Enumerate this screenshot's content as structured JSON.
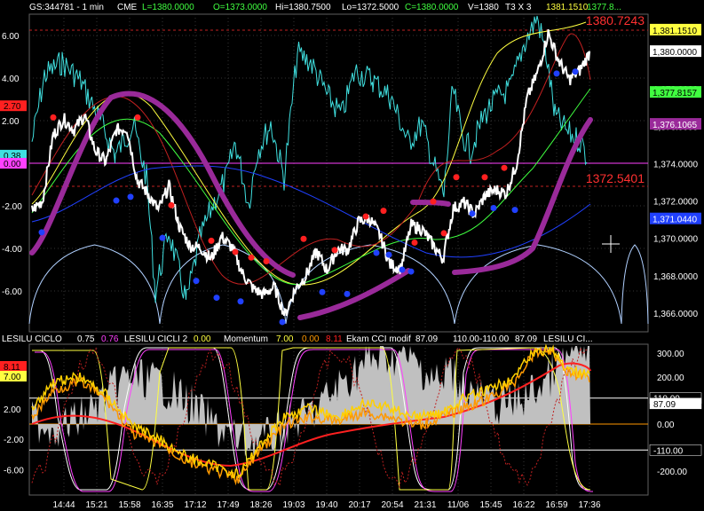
{
  "header": {
    "symbol": "GS:344781 - 1 min",
    "exchange": "CME",
    "last": "L=1380.0000",
    "open": "O=1373.0000",
    "high": "Hi=1380.7500",
    "low": "Lo=1372.5000",
    "close": "C=1380.0000",
    "volume": "V=1380",
    "chart_setting": "T3 X 3",
    "value_a": "1381.1510",
    "value_b": "1377.8..."
  },
  "colors": {
    "background": "#000000",
    "price": "#ffffff",
    "cyan_line": "#40e0e0",
    "purple_band": "#9a2a9a",
    "magenta_line": "#ff40ff",
    "red_dot": "#ff2020",
    "blue_dot": "#2040ff",
    "yellow": "#ffff40",
    "orange": "#ff9900",
    "grey_fill": "#c0c0c0"
  },
  "upper_panel": {
    "right_axis_ticks": [
      "1,380.0000",
      "1,378.0000",
      "1,376.0000",
      "1,374.0000",
      "1,372.0000",
      "1,370.0000",
      "1,368.0000",
      "1,366.0000"
    ],
    "left_axis_ticks": [
      "6.00",
      "4.00",
      "2.00",
      "0.00",
      "-2.00",
      "-4.00",
      "-6.00"
    ],
    "level_top": "1380.7243",
    "level_bottom": "1372.5401",
    "badges": [
      {
        "text": "1,381.1510",
        "bg": "#ffff40",
        "fg": "#000000"
      },
      {
        "text": "1,380.0000",
        "bg": "#ffffff",
        "fg": "#000000"
      },
      {
        "text": "1,377.8157",
        "bg": "#40ff40",
        "fg": "#000000"
      },
      {
        "text": "1,376.1065",
        "bg": "#9a2a9a",
        "fg": "#ffffff"
      },
      {
        "text": "1,371.0440",
        "bg": "#2040ff",
        "fg": "#ffffff"
      }
    ],
    "left_badges": [
      {
        "text": "2.70",
        "bg": "#ff2020"
      },
      {
        "text": "0.38",
        "bg": "#40e0e0"
      },
      {
        "text": "0.00",
        "bg": "#ff40ff"
      }
    ]
  },
  "lower_panel": {
    "legend": [
      {
        "text": "LESILU CICLO",
        "color": "#ffffff"
      },
      {
        "text": "0.75",
        "color": "#ffffff"
      },
      {
        "text": "0.76",
        "color": "#ff40ff"
      },
      {
        "text": "LESILU CICLI 2",
        "color": "#ffffff"
      },
      {
        "text": "0.00",
        "color": "#ffff40"
      },
      {
        "text": "Momentum",
        "color": "#ffffff"
      },
      {
        "text": "7.00",
        "color": "#ffff40"
      },
      {
        "text": "0.00",
        "color": "#ff9900"
      },
      {
        "text": "8.11",
        "color": "#ff2020"
      },
      {
        "text": "Ekam CCI modif",
        "color": "#ffffff"
      },
      {
        "text": "87.09",
        "color": "#ffffff"
      },
      {
        "text": "110.00",
        "color": "#ffffff"
      },
      {
        "text": "-110.00",
        "color": "#ffffff"
      },
      {
        "text": "87.09",
        "color": "#ffffff"
      },
      {
        "text": "LESILU CI...",
        "color": "#ffffff"
      }
    ],
    "right_axis_ticks": [
      "300.00",
      "200.00",
      "0.00",
      "-200.00"
    ],
    "left_axis_ticks": [
      "2.00",
      "-2.00",
      "-6.00"
    ],
    "right_badges": [
      "110.00",
      "87.09",
      "-110.00"
    ],
    "left_badges": [
      {
        "text": "8.11",
        "bg": "#ff2020"
      },
      {
        "text": "7.00",
        "bg": "#ffff40"
      }
    ]
  },
  "time_axis": [
    "14:44",
    "15:21",
    "15:58",
    "16:35",
    "17:12",
    "17:49",
    "18:26",
    "19:03",
    "19:40",
    "20:17",
    "20:54",
    "21:31",
    "11/06",
    "15:45",
    "16:22",
    "16:59",
    "17:36"
  ],
  "chart_data": {
    "type": "line",
    "price_series": {
      "name": "GS:344781",
      "ylim": [
        1365,
        1382
      ],
      "values": [
        1371.5,
        1372,
        1375.5,
        1376.4,
        1375.8,
        1376.6,
        1374.7,
        1374.1,
        1375.8,
        1375.9,
        1373.1,
        1372.4,
        1371.5,
        1372.8,
        1370.6,
        1369.6,
        1369.5,
        1368.9,
        1370.1,
        1369.5,
        1368.1,
        1367.3,
        1367.0,
        1367.4,
        1365.9,
        1367.3,
        1368.0,
        1369.3,
        1368.3,
        1369.4,
        1369.4,
        1370.9,
        1371.1,
        1370.2,
        1368.6,
        1368.4,
        1370.7,
        1370.5,
        1369.7,
        1368.9,
        1371.6,
        1371.9,
        1371.3,
        1372.3,
        1372.6,
        1372.4,
        1374.0,
        1377.5,
        1378.9,
        1381.0,
        1379.5,
        1378.5,
        1379.0,
        1380.0
      ]
    },
    "red_dots": [
      1376.0,
      1376.0,
      1371.3,
      1369.4,
      1368.8,
      1368.5,
      1368.3,
      1369.5,
      1368.9,
      1370.7,
      1371.0,
      1371.5,
      1369.3,
      1369.8,
      1372.8,
      1372.8,
      1373.3
    ],
    "blue_dots": [
      1370.8,
      1372.5,
      1372.7,
      1370.5,
      1368.2,
      1367.3,
      1367.1,
      1366.0,
      1367.6,
      1367.5,
      1369.7,
      1369.6,
      1368.8,
      1368.7,
      1371.8,
      1372.1,
      1372.0,
      1379.3,
      1379.4
    ],
    "momentum": {
      "name": "Momentum",
      "ylim": [
        -8,
        8
      ]
    },
    "cci": {
      "name": "Ekam CCI modif",
      "ylim": [
        -300,
        350
      ],
      "levels": [
        110,
        -110
      ]
    }
  }
}
